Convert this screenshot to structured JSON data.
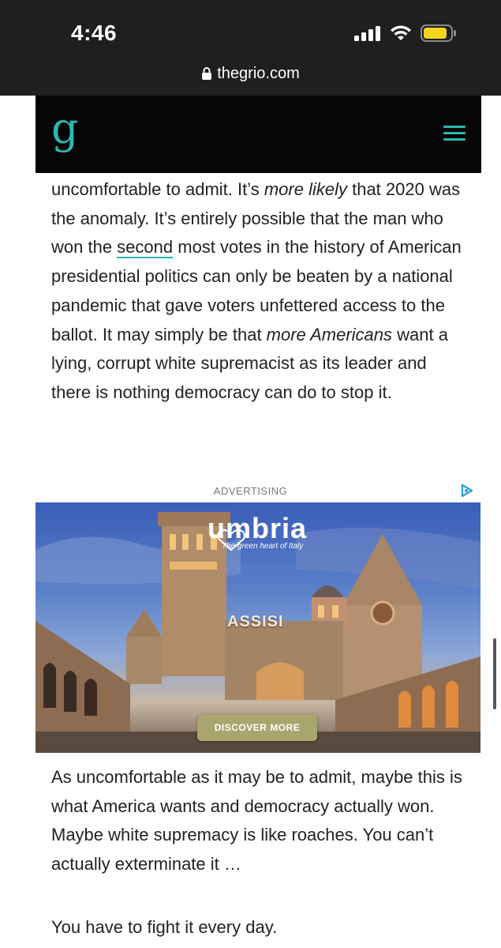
{
  "status_bar": {
    "time": "4:46",
    "icons": [
      "cellular-signal-icon",
      "wifi-icon",
      "battery-icon"
    ]
  },
  "browser": {
    "url": "thegrio.com",
    "icons": [
      "lock-icon"
    ]
  },
  "site": {
    "logo": "g",
    "logo_color": "#2ab8b0",
    "header_bg": "#050505",
    "icons": [
      "hamburger-menu-icon"
    ]
  },
  "article": {
    "para1": {
      "s1": "uncomfortable to admit. It’s ",
      "s1_em": "more likely",
      "s2": " that 2020 was the anomaly. It’s entirely possible that the man who won the ",
      "s2_link": "second",
      "s3": " most votes in the history of American presidential politics can only be beaten by a national pandemic that gave voters unfettered access to the ballot. It may simply be that ",
      "s3_em": "more Americans",
      "s4": " want a lying, corrupt white supremacist as its leader and there is nothing democracy can do to stop it."
    },
    "para2": "As uncomfortable as it may be to admit, maybe this is what America wants and democracy actually won. Maybe white supremacy is like roaches. You can’t actually exterminate it …",
    "para3": "You have to fight it every day."
  },
  "ad": {
    "label": "ADVERTISING",
    "brand": "umbria",
    "tagline": "The green heart of Italy",
    "place": "ASSISI",
    "cta": "DISCOVER MORE",
    "cta_color": "#a9a56e",
    "icons": [
      "adchoices-icon"
    ]
  }
}
